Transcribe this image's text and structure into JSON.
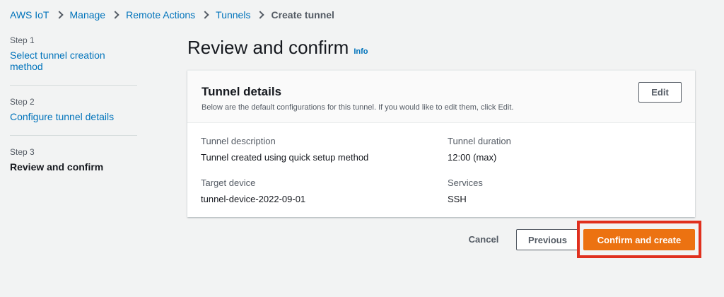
{
  "breadcrumb": {
    "items": [
      "AWS IoT",
      "Manage",
      "Remote Actions",
      "Tunnels"
    ],
    "current": "Create tunnel"
  },
  "steps": [
    {
      "num": "Step 1",
      "label": "Select tunnel creation method"
    },
    {
      "num": "Step 2",
      "label": "Configure tunnel details"
    },
    {
      "num": "Step 3",
      "label": "Review and confirm"
    }
  ],
  "page": {
    "title": "Review and confirm",
    "info": "Info"
  },
  "panel": {
    "title": "Tunnel details",
    "description": "Below are the default configurations for this tunnel. If you would like to edit them, click Edit.",
    "edit_label": "Edit",
    "fields": {
      "description": {
        "label": "Tunnel description",
        "value": "Tunnel created using quick setup method"
      },
      "duration": {
        "label": "Tunnel duration",
        "value": "12:00 (max)"
      },
      "device": {
        "label": "Target device",
        "value": "tunnel-device-2022-09-01"
      },
      "services": {
        "label": "Services",
        "value": "SSH"
      }
    }
  },
  "actions": {
    "cancel": "Cancel",
    "previous": "Previous",
    "confirm": "Confirm and create"
  },
  "colors": {
    "link": "#0073bb",
    "primary": "#ec7211",
    "highlight": "#e0301e",
    "background": "#f2f3f3"
  }
}
